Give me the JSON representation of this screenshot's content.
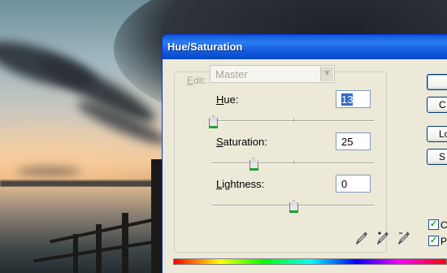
{
  "window": {
    "title": "Hue/Saturation"
  },
  "edit": {
    "label_prefix": "E",
    "label_rest": "dit:",
    "selected": "Master"
  },
  "sliders": [
    {
      "label_prefix": "H",
      "label_rest": "ue:",
      "value": "13",
      "level": 0.0,
      "selected": true
    },
    {
      "label_prefix": "S",
      "label_rest": "aturation:",
      "value": "25",
      "level": 0.25,
      "selected": false
    },
    {
      "label_prefix": "L",
      "label_rest": "ightness:",
      "value": "0",
      "level": 0.5,
      "selected": false
    }
  ],
  "buttons": [
    {
      "label": ""
    },
    {
      "label": "C"
    },
    {
      "label": "Lo"
    },
    {
      "label": "S"
    }
  ],
  "checkboxes": [
    {
      "label": "Co",
      "checked": true
    },
    {
      "label": "Pr",
      "checked": true
    }
  ],
  "icons": {
    "eyedropper": "eyedropper-icon",
    "eyedropper_plus": "eyedropper-plus-icon",
    "eyedropper_minus": "eyedropper-minus-icon",
    "dropdown": "chevron-down-icon"
  },
  "colors": {
    "titlebar": "#0a5ad8",
    "dialog_bg": "#ece9d8",
    "thumb_base": "#22a032"
  }
}
